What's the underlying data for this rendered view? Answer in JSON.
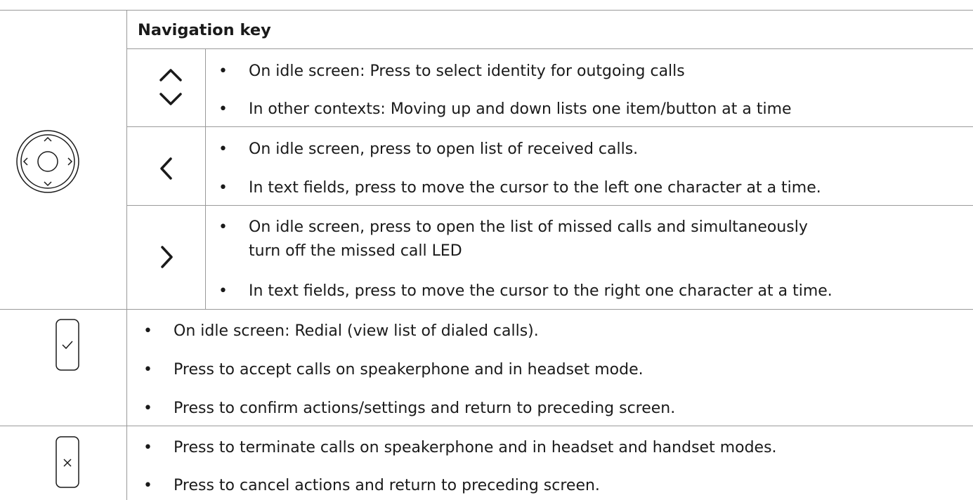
{
  "section": {
    "heading": "Navigation key",
    "navigation": [
      {
        "icon": "chevron-up-down-icon",
        "items": [
          "On idle screen:  Press to select identity for outgoing calls",
          "In other contexts:  Moving up and down lists one item/button at a time"
        ]
      },
      {
        "icon": "chevron-left-icon",
        "items": [
          "On idle screen, press to open list of received calls.",
          "In text fields, press to move the cursor to the left one character at a time."
        ]
      },
      {
        "icon": "chevron-right-icon",
        "items": [
          "On idle screen, press to open the list of missed calls and simultaneously",
          "turn off the missed call LED",
          "In text fields, press to move the cursor to the right one character at a time."
        ]
      }
    ],
    "nav_key_icon": "navigation-key-icon"
  },
  "confirm_key": {
    "icon": "checkmark-key-icon",
    "items": [
      "On idle screen:  Redial (view list of dialed calls).",
      "Press to accept calls on speakerphone and in headset mode.",
      "Press to confirm actions/settings and return to preceding screen."
    ]
  },
  "cancel_key": {
    "icon": "cross-key-icon",
    "items": [
      "Press to terminate calls on speakerphone and in headset and handset modes.",
      "Press to cancel actions and return to preceding screen."
    ]
  },
  "bullet": "•"
}
